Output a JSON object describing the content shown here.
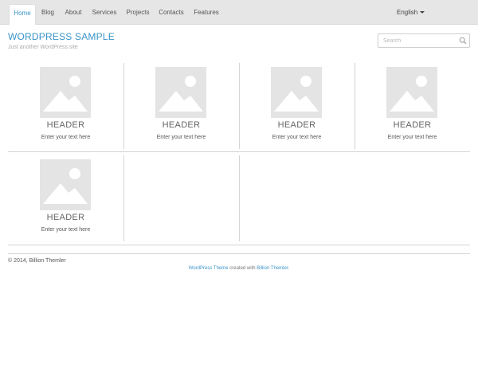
{
  "nav": {
    "items": [
      {
        "label": "Home"
      },
      {
        "label": "Blog"
      },
      {
        "label": "About"
      },
      {
        "label": "Services"
      },
      {
        "label": "Projects"
      },
      {
        "label": "Contacts"
      },
      {
        "label": "Features"
      }
    ],
    "language": "English"
  },
  "site": {
    "title": "WORDPRESS SAMPLE",
    "tagline": "Just another WordPress site"
  },
  "search": {
    "placeholder": "Search"
  },
  "cards": [
    {
      "header": "HEADER",
      "text": "Enter your text here"
    },
    {
      "header": "HEADER",
      "text": "Enter your text here"
    },
    {
      "header": "HEADER",
      "text": "Enter your text here"
    },
    {
      "header": "HEADER",
      "text": "Enter your text here"
    },
    {
      "header": "HEADER",
      "text": "Enter your text here"
    }
  ],
  "footer": {
    "copyright": "© 2014, Billion Themler",
    "theme_link": "WordPress Theme",
    "created_with": "created with",
    "author_link": "Billion Themler",
    "period": "."
  },
  "colors": {
    "accent": "#3a94c9",
    "navbar_bg": "#e6e6e6",
    "placeholder_bg": "#e4e4e4"
  }
}
